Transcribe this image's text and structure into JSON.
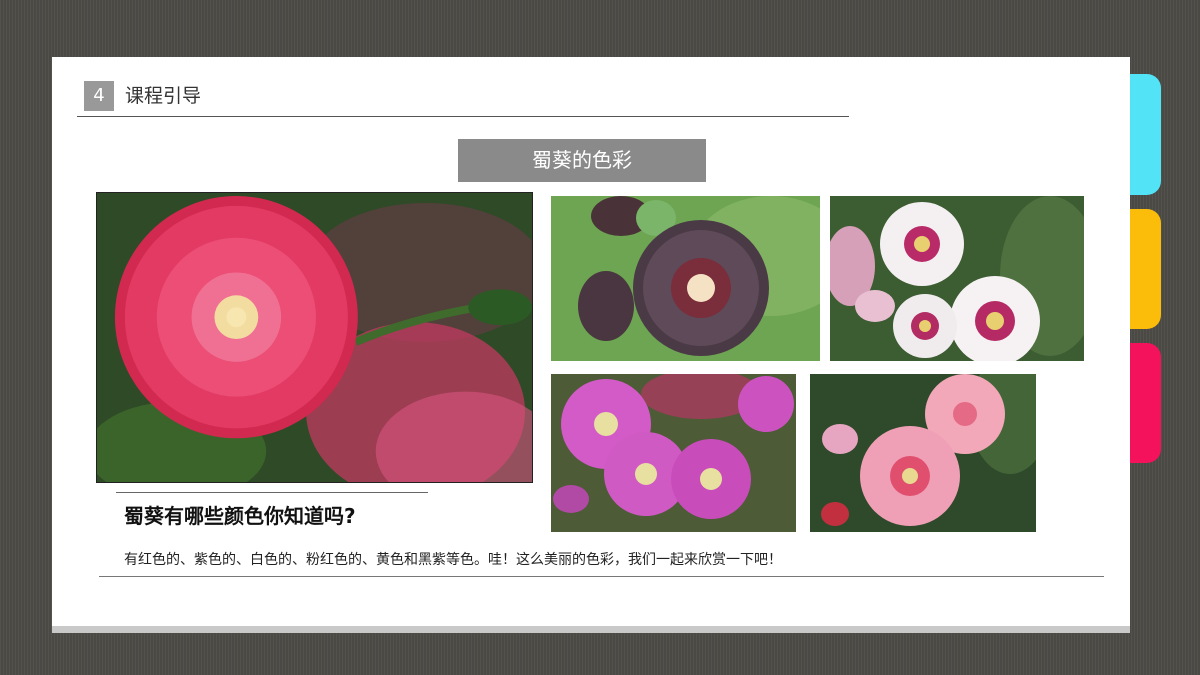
{
  "header": {
    "number": "4",
    "section_title": "课程引导"
  },
  "banner": {
    "title": "蜀葵的色彩"
  },
  "content": {
    "question": "蜀葵有哪些颜色你知道吗?",
    "answer": "有红色的、紫色的、白色的、粉红色的、黄色和黑紫等色。哇！这么美丽的色彩，我们一起来欣赏一下吧！"
  },
  "colors": {
    "tab_cyan": "#52e3f7",
    "tab_yellow": "#fcbc0a",
    "tab_pink": "#f4125c",
    "banner_bg": "#8a8a8a",
    "number_box_bg": "#999999"
  },
  "photos": [
    {
      "id": "main",
      "subject": "red-hollyhock-photo"
    },
    {
      "id": "top-left",
      "subject": "black-purple-hollyhock-photo"
    },
    {
      "id": "top-right",
      "subject": "white-hollyhock-photo"
    },
    {
      "id": "bottom-left",
      "subject": "magenta-hollyhock-photo"
    },
    {
      "id": "bottom-right",
      "subject": "pink-hollyhock-photo"
    }
  ]
}
